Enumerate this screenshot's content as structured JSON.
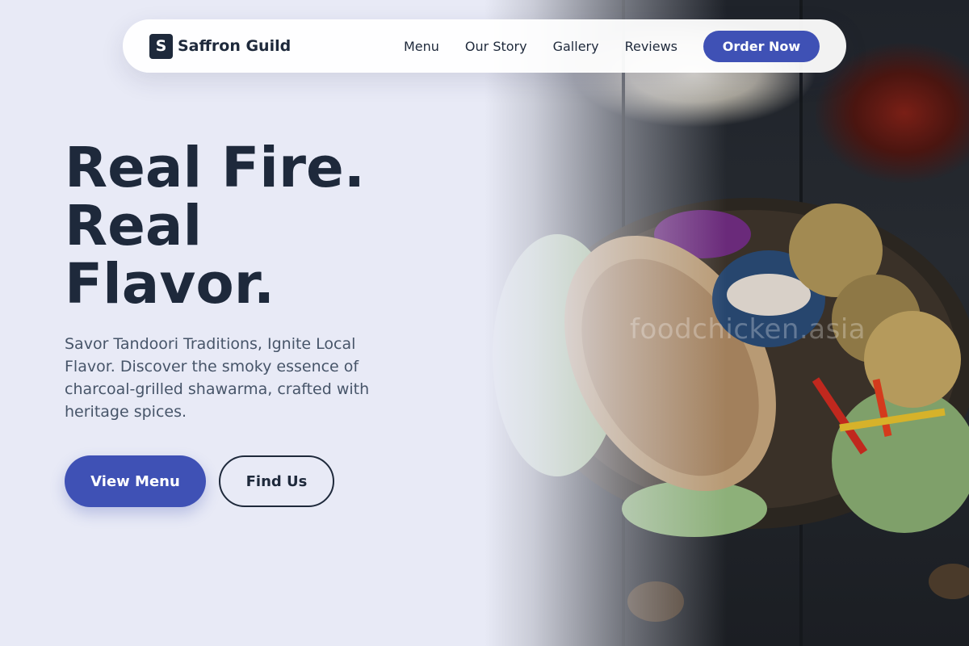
{
  "brand": {
    "logo_letter": "S",
    "name": "Saffron Guild"
  },
  "nav": {
    "links": [
      "Menu",
      "Our Story",
      "Gallery",
      "Reviews"
    ],
    "cta": "Order Now"
  },
  "hero": {
    "headline": [
      "Real Fire.",
      "Real",
      "Flavor."
    ],
    "subtitle": "Savor Tandoori Traditions, Ignite Local Flavor. Discover the smoky essence of charcoal-grilled shawarma, crafted with heritage spices.",
    "primary_button": "View Menu",
    "secondary_button": "Find Us",
    "watermark": "foodchicken.asia"
  },
  "colors": {
    "background": "#e8eaf6",
    "accent": "#3f51b5",
    "text_dark": "#1e293b",
    "text_muted": "#475569"
  }
}
